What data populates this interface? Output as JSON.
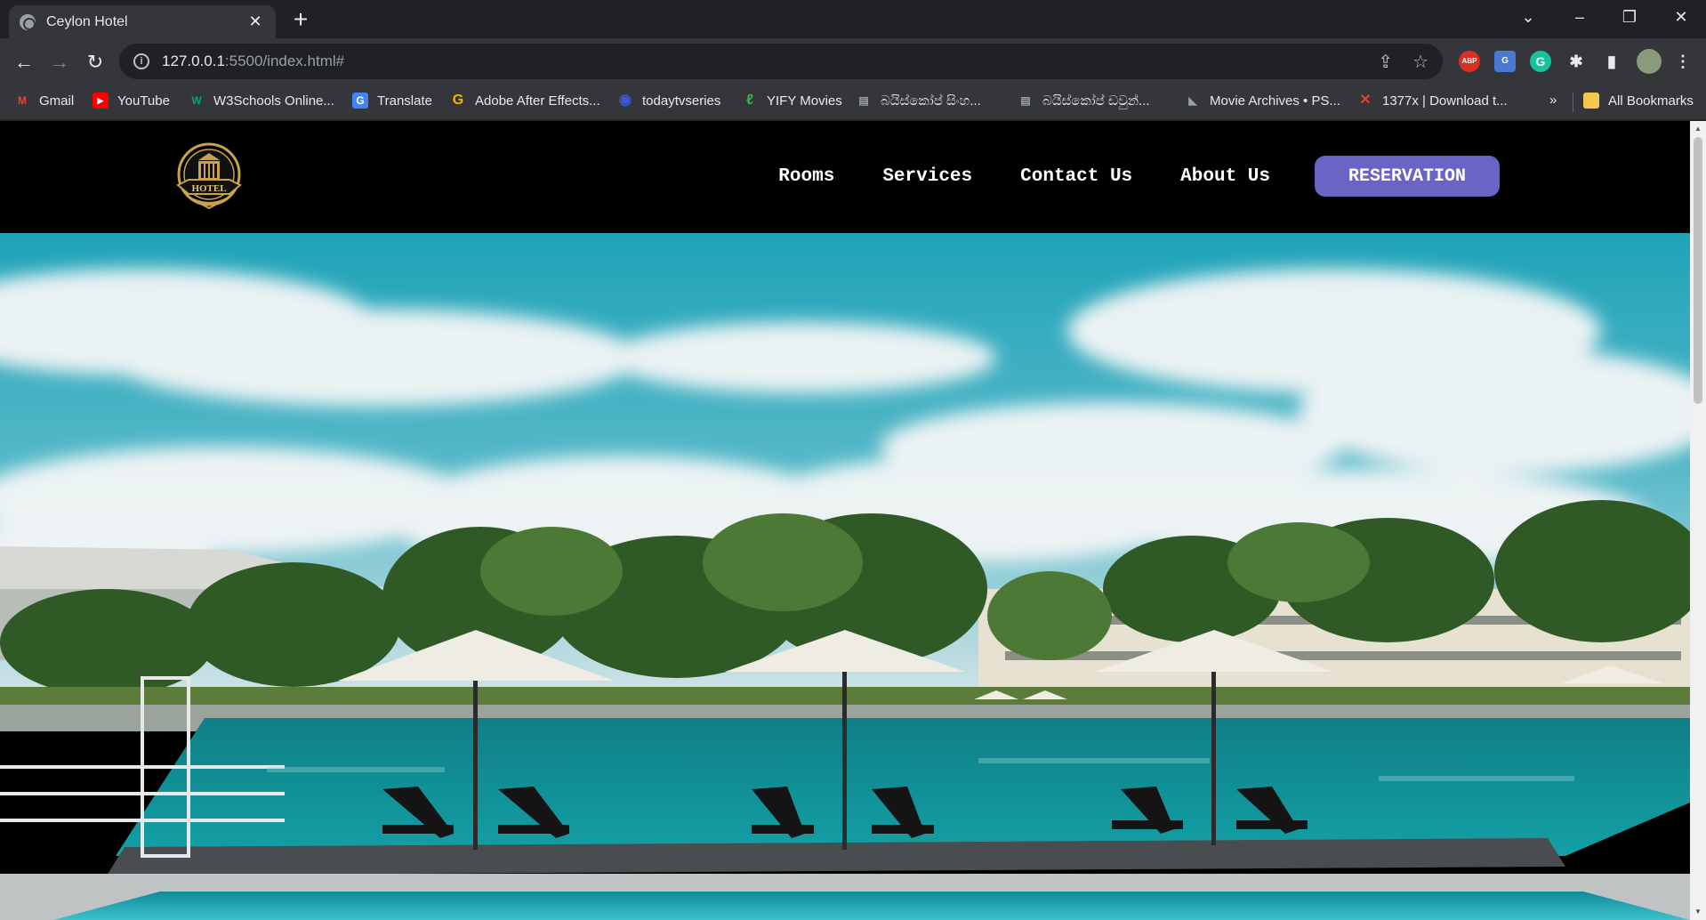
{
  "browser": {
    "tab_title": "Ceylon Hotel",
    "url_host": "127.0.0.1",
    "url_rest": ":5500/index.html#"
  },
  "bookmarks": [
    {
      "label": "Gmail",
      "icon": "gmail-icon",
      "color": "#ea4335"
    },
    {
      "label": "YouTube",
      "icon": "youtube-icon",
      "color": "#ff0000"
    },
    {
      "label": "W3Schools Online...",
      "icon": "w3schools-icon",
      "color": "#04aa6d"
    },
    {
      "label": "Translate",
      "icon": "translate-icon",
      "color": "#4285f4"
    },
    {
      "label": "Adobe After Effects...",
      "icon": "g-icon",
      "color": "#f5b301"
    },
    {
      "label": "todaytvseries",
      "icon": "globe-icon",
      "color": "#3b5bdb"
    },
    {
      "label": "YIFY Movies",
      "icon": "yify-icon",
      "color": "#3bb44a"
    },
    {
      "label": "බයිස්කෝප් සිංහ...",
      "icon": "film-icon",
      "color": "#9aa0a6"
    },
    {
      "label": "බයිස්කෝප් ඩවුන්...",
      "icon": "film-icon",
      "color": "#9aa0a6"
    },
    {
      "label": "Movie Archives • PS...",
      "icon": "psa-icon",
      "color": "#9aa0a6"
    },
    {
      "label": "1377x | Download t...",
      "icon": "x-icon",
      "color": "#e8422c"
    }
  ],
  "bookmarks_overflow": "»",
  "all_bookmarks_label": "All Bookmarks",
  "site": {
    "nav": [
      "Rooms",
      "Services",
      "Contact Us",
      "About Us"
    ],
    "reserve_label": "RESERVATION",
    "logo_text": "HOTEL",
    "accent_color": "#6a64c4"
  }
}
